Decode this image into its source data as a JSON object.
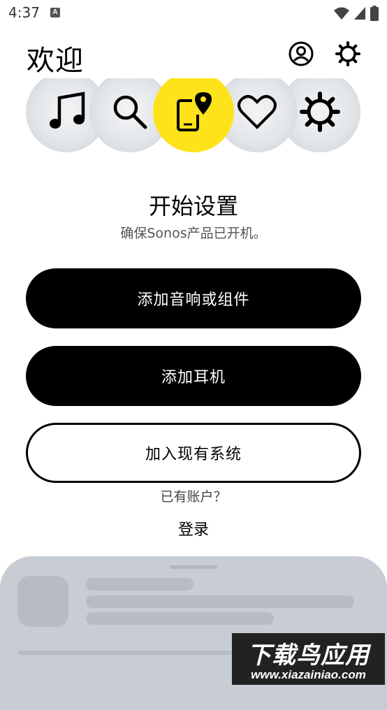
{
  "status_bar": {
    "time": "4:37",
    "notification_letter": "A"
  },
  "header": {
    "title": "欢迎"
  },
  "carousel": {
    "items": [
      {
        "icon": "music-note-icon"
      },
      {
        "icon": "search-icon"
      },
      {
        "icon": "phone-location-icon",
        "active": true
      },
      {
        "icon": "heart-icon"
      },
      {
        "icon": "gear-icon"
      }
    ],
    "active_color": "#ffe31a"
  },
  "setup": {
    "title": "开始设置",
    "subtitle": "确保Sonos产品已开机。"
  },
  "buttons": {
    "add_speaker": "添加音响或组件",
    "add_headphones": "添加耳机",
    "join_system": "加入现有系统"
  },
  "account": {
    "prompt": "已有账户？",
    "login": "登录"
  },
  "watermark": {
    "main": "下载鸟应用",
    "url": "www.xiazainiao.com"
  }
}
